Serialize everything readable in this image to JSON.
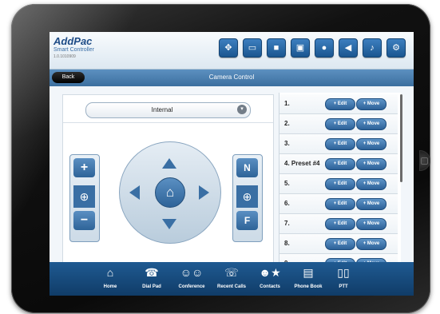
{
  "header": {
    "app_title": "AddPac",
    "app_subtitle": "Smart Controller",
    "version": "1.0.1010909",
    "toolbar_icons": [
      "move-icon",
      "screen-icon",
      "camera-icon",
      "monitor-icon",
      "microphone-icon",
      "speaker-icon",
      "music-icon",
      "tools-icon"
    ]
  },
  "navbar": {
    "back_label": "Back",
    "title": "Camera Control"
  },
  "camera": {
    "source": "Internal",
    "zoom_plus": "+",
    "zoom_minus": "−",
    "focus_near": "N",
    "focus_far": "F"
  },
  "presets": {
    "edit_label": "Edit",
    "move_label": "Move",
    "items": [
      "1.",
      "2.",
      "3.",
      "4. Preset #4",
      "5.",
      "6.",
      "7.",
      "8.",
      "9."
    ]
  },
  "tabbar": {
    "items": [
      {
        "label": "Home",
        "icon": "home-icon"
      },
      {
        "label": "Dial Pad",
        "icon": "dial-pad-icon"
      },
      {
        "label": "Conference",
        "icon": "conference-icon"
      },
      {
        "label": "Recent Calls",
        "icon": "recent-calls-icon"
      },
      {
        "label": "Contacts",
        "icon": "contacts-icon"
      },
      {
        "label": "Phone Book",
        "icon": "phone-book-icon"
      },
      {
        "label": "PTT",
        "icon": "ptt-icon"
      }
    ]
  },
  "colors": {
    "accent": "#2e6398",
    "navbar": "#4a80b2",
    "tabbar": "#15467a"
  }
}
